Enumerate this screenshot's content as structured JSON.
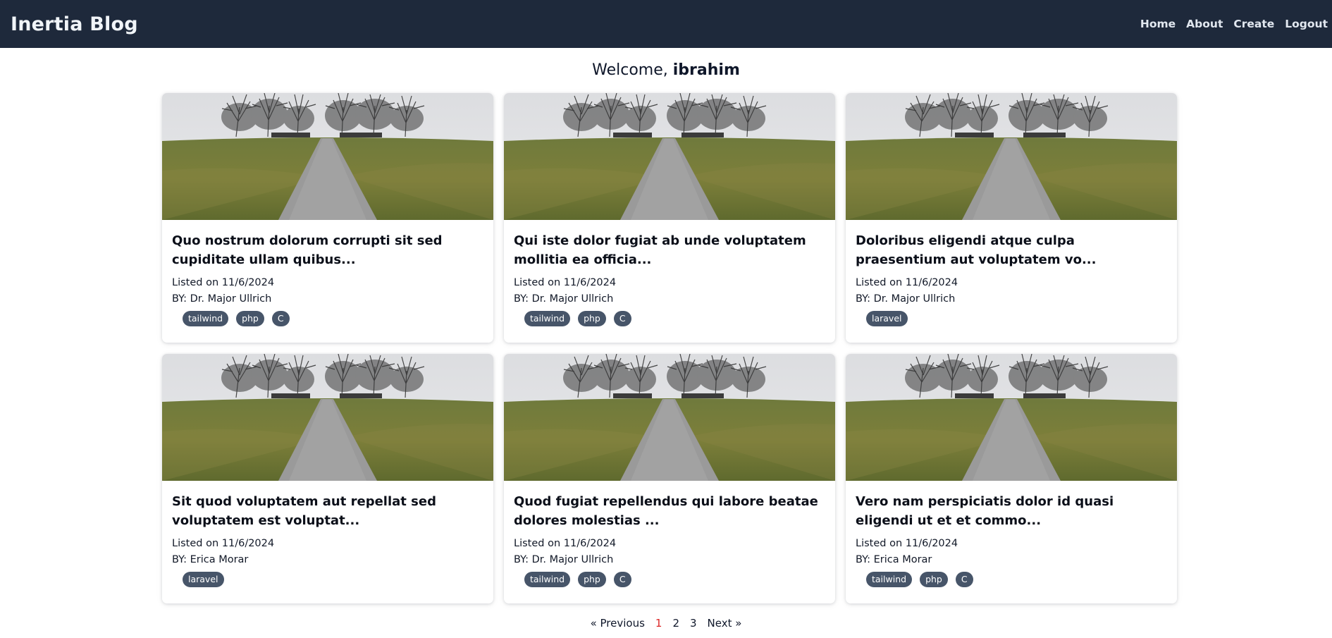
{
  "nav": {
    "brand": "Inertia Blog",
    "links": [
      "Home",
      "About",
      "Create",
      "Logout"
    ]
  },
  "welcome": {
    "prefix": "Welcome, ",
    "username": "ibrahim"
  },
  "posts": [
    {
      "title": "Quo nostrum dolorum corrupti sit sed cupiditate ullam quibus...",
      "listed": "Listed on 11/6/2024",
      "author": "BY: Dr. Major Ullrich",
      "tags": [
        "tailwind",
        "php",
        "C"
      ]
    },
    {
      "title": "Qui iste dolor fugiat ab unde voluptatem mollitia ea officia...",
      "listed": "Listed on 11/6/2024",
      "author": "BY: Dr. Major Ullrich",
      "tags": [
        "tailwind",
        "php",
        "C"
      ]
    },
    {
      "title": "Doloribus eligendi atque culpa praesentium aut voluptatem vo...",
      "listed": "Listed on 11/6/2024",
      "author": "BY: Dr. Major Ullrich",
      "tags": [
        "laravel"
      ]
    },
    {
      "title": "Sit quod voluptatem aut repellat sed voluptatem est voluptat...",
      "listed": "Listed on 11/6/2024",
      "author": "BY: Erica Morar",
      "tags": [
        "laravel"
      ]
    },
    {
      "title": "Quod fugiat repellendus qui labore beatae dolores molestias ...",
      "listed": "Listed on 11/6/2024",
      "author": "BY: Dr. Major Ullrich",
      "tags": [
        "tailwind",
        "php",
        "C"
      ]
    },
    {
      "title": "Vero nam perspiciatis dolor id quasi eligendi ut et et commo...",
      "listed": "Listed on 11/6/2024",
      "author": "BY: Erica Morar",
      "tags": [
        "tailwind",
        "php",
        "C"
      ]
    }
  ],
  "pagination": {
    "previous": "« Previous",
    "pages": [
      "1",
      "2",
      "3"
    ],
    "current": "1",
    "next": "Next »"
  },
  "colors": {
    "navbar": "#1e293b",
    "tag": "#475569",
    "active_page": "#dc2626"
  }
}
